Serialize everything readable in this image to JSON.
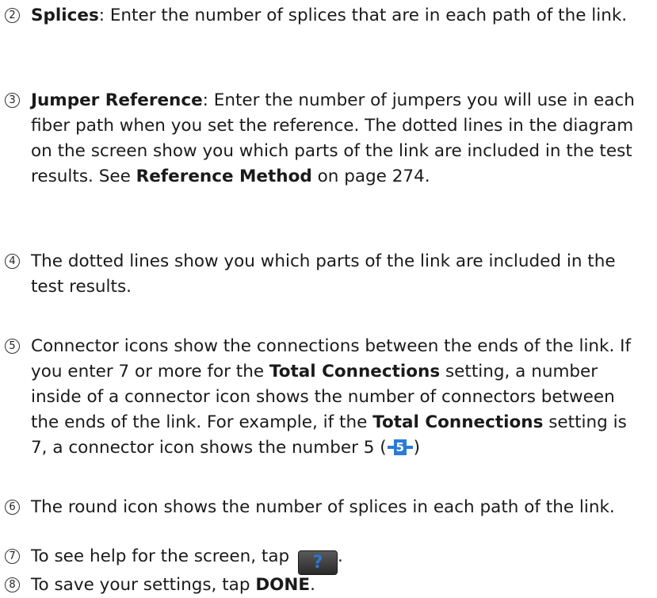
{
  "items": [
    {
      "num": "2",
      "term": "Splices",
      "text": ": Enter the number of splices that are in each path of the link."
    },
    {
      "num": "3",
      "term": "Jumper Reference",
      "text_a": ": Enter the number of jumpers you will use in each fiber path when you set the reference. The dotted lines in the diagram on the screen show you which parts of the link are included in the test results. See ",
      "ref": "Reference Method",
      "text_b": " on page 274."
    },
    {
      "num": "4",
      "text": "The dotted lines show you which parts of the link are included in the test results."
    },
    {
      "num": "5",
      "text_a": "Connector icons show the connections between the ends of the link. If you enter 7 or more for the ",
      "term_a": "Total Connections",
      "text_b": " setting, a number inside of a connector icon shows the number of connectors between the ends of the link. For example, if the ",
      "term_b": "Total Connections",
      "text_c": " setting is 7, a connector icon shows the number 5 (",
      "icon_value": "5",
      "text_d": ")"
    },
    {
      "num": "6",
      "text": "The round icon shows the number of splices in each path of the link."
    },
    {
      "num": "7",
      "text_a": "To see help for the screen, tap ",
      "icon_value": "?",
      "text_b": "."
    },
    {
      "num": "8",
      "text_a": "To save your settings, tap ",
      "term": "DONE",
      "text_b": "."
    }
  ],
  "icons": {
    "connector_color": "#2b7bd6",
    "help_bg": "#3a3a3a",
    "help_fg": "#2f76d2"
  }
}
